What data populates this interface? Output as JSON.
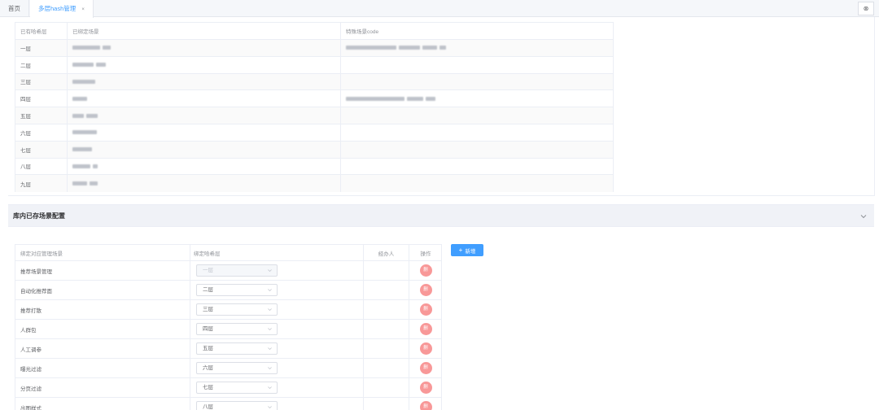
{
  "tabs": {
    "home": "首页",
    "active": "多层hash管理",
    "close_glyph": "×",
    "bar_close_glyph": "⊗"
  },
  "top_table": {
    "headers": [
      "已有哈希层",
      "已绑定场景",
      "特殊场景code"
    ],
    "rows": [
      {
        "layer": "一层",
        "scene": [
          34,
          10
        ],
        "code": [
          62,
          26,
          18,
          8
        ]
      },
      {
        "layer": "二层",
        "scene": [
          26,
          12
        ],
        "code": []
      },
      {
        "layer": "三层",
        "scene": [
          28
        ],
        "code": []
      },
      {
        "layer": "四层",
        "scene": [
          18
        ],
        "code": [
          72,
          20,
          12
        ]
      },
      {
        "layer": "五层",
        "scene": [
          14,
          14
        ],
        "code": []
      },
      {
        "layer": "六层",
        "scene": [
          30
        ],
        "code": []
      },
      {
        "layer": "七层",
        "scene": [
          24
        ],
        "code": []
      },
      {
        "layer": "八层",
        "scene": [
          22,
          6
        ],
        "code": []
      },
      {
        "layer": "九层",
        "scene": [
          18,
          10
        ],
        "code": []
      }
    ]
  },
  "scene_section": {
    "title": "库内已存场景配置"
  },
  "config_table": {
    "headers": [
      "绑定对应管理场景",
      "绑定哈希层",
      "经办人",
      "操作"
    ],
    "rows": [
      {
        "scene": "推荐场景管理",
        "layer": "一层",
        "disabled": true
      },
      {
        "scene": "自动化推荐面",
        "layer": "二层",
        "disabled": false
      },
      {
        "scene": "推荐打散",
        "layer": "三层",
        "disabled": false
      },
      {
        "scene": "人群包",
        "layer": "四层",
        "disabled": false
      },
      {
        "scene": "人工调参",
        "layer": "五层",
        "disabled": false
      },
      {
        "scene": "曝光过滤",
        "layer": "六层",
        "disabled": false
      },
      {
        "scene": "分页过滤",
        "layer": "七层",
        "disabled": false
      },
      {
        "scene": "出图样式",
        "layer": "八层",
        "disabled": false
      }
    ],
    "delete_label": "删"
  },
  "add_button": {
    "plus": "+",
    "label": "新增"
  },
  "colors": {
    "accent": "#409eff",
    "danger": "#f89898",
    "header_bg": "#f0f2f7"
  }
}
